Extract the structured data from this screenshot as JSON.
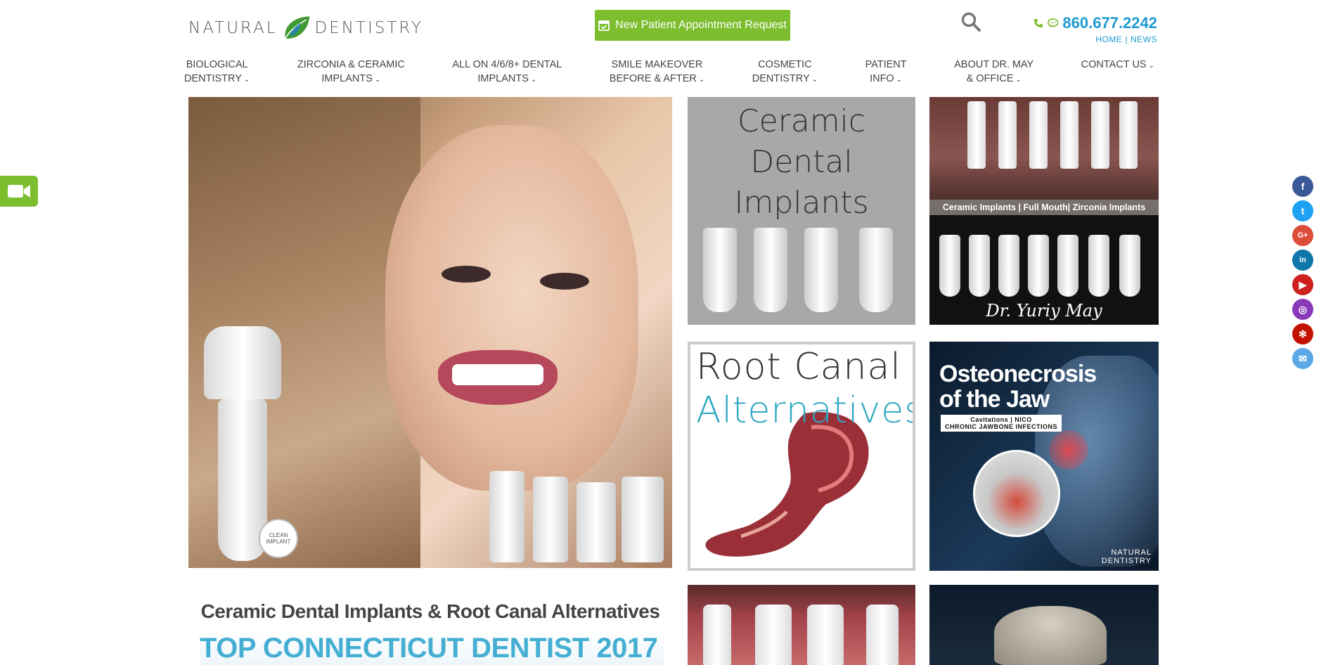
{
  "logo": {
    "left_text": "NATURAL",
    "right_text": "DENTISTRY"
  },
  "header": {
    "appointment_label": "New Patient Appointment Request",
    "phone": "860.677.2242",
    "links": [
      "HOME",
      "NEWS"
    ]
  },
  "nav": {
    "items": [
      {
        "line1": "BIOLOGICAL",
        "line2": "DENTISTRY"
      },
      {
        "line1": "ZIRCONIA & CERAMIC",
        "line2": "IMPLANTS"
      },
      {
        "line1": "ALL ON 4/6/8+ DENTAL",
        "line2": "IMPLANTS"
      },
      {
        "line1": "SMILE MAKEOVER",
        "line2": "BEFORE & AFTER"
      },
      {
        "line1": "COSMETIC",
        "line2": "DENTISTRY"
      },
      {
        "line1": "PATIENT",
        "line2": "INFO"
      },
      {
        "line1": "ABOUT DR. MAY",
        "line2": "& OFFICE"
      },
      {
        "line1": "CONTACT US",
        "line2": ""
      }
    ]
  },
  "tiles": {
    "hero_badge": "CLEAN IMPLANT",
    "ceramic": {
      "line1": "Ceramic",
      "line2": "Dental",
      "line3": "Implants"
    },
    "zirconia_caption": "Ceramic Implants | Full Mouth| Zirconia Implants",
    "signature": "Dr. Yuriy May",
    "root_canal": {
      "line1": "Root Canal",
      "line2": "Alternatives"
    },
    "osteo": {
      "line1": "Osteonecrosis",
      "line2": "of the Jaw",
      "sub1": "Cavitations | NICO",
      "sub2": "CHRONIC JAWBONE INFECTIONS"
    },
    "osteo_logo": {
      "line1": "NATURAL",
      "line2": "DENTISTRY"
    },
    "banner_title": "Ceramic Dental Implants & Root Canal Alternatives",
    "banner_sub": "TOP CONNECTICUT DENTIST 2017"
  },
  "social": [
    {
      "name": "facebook-icon",
      "glyph": "f",
      "color": "#3b5998"
    },
    {
      "name": "twitter-icon",
      "glyph": "t",
      "color": "#1da1f2"
    },
    {
      "name": "google-plus-icon",
      "glyph": "G+",
      "color": "#dd4b39"
    },
    {
      "name": "linkedin-icon",
      "glyph": "in",
      "color": "#0e76a8"
    },
    {
      "name": "youtube-icon",
      "glyph": "▶",
      "color": "#cd201f"
    },
    {
      "name": "instagram-icon",
      "glyph": "◎",
      "color": "#8a3ab9"
    },
    {
      "name": "yelp-icon",
      "glyph": "✻",
      "color": "#c41200"
    },
    {
      "name": "email-icon",
      "glyph": "✉",
      "color": "#5aa9e6"
    }
  ],
  "colors": {
    "accent_green": "#7dbe2e",
    "link_blue": "#1d9bd1"
  }
}
